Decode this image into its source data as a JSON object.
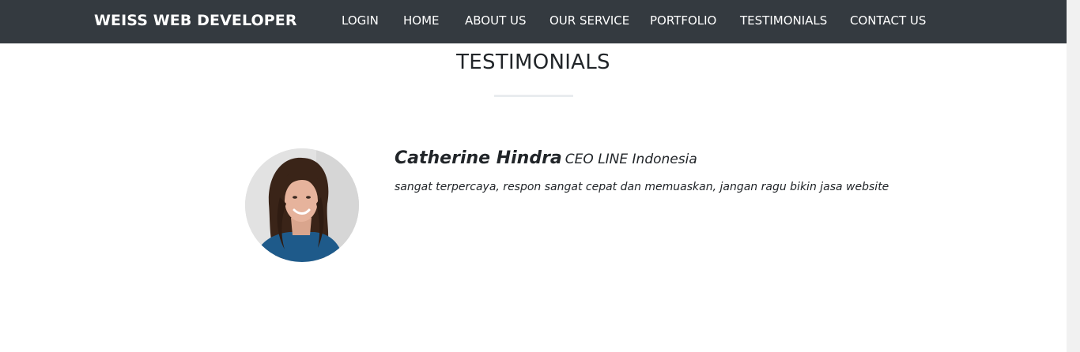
{
  "navbar": {
    "brand": "WEISS WEB DEVELOPER",
    "links": [
      {
        "label": "LOGIN"
      },
      {
        "label": "HOME"
      },
      {
        "label": "ABOUT US"
      },
      {
        "label": "OUR SERVICE"
      },
      {
        "label": "PORTFOLIO"
      },
      {
        "label": "TESTIMONIALS"
      },
      {
        "label": "CONTACT US"
      }
    ]
  },
  "testimonials": {
    "title": "TESTIMONIALS",
    "items": [
      {
        "name": "Catherine Hindra",
        "role": "CEO LINE Indonesia",
        "quote": "sangat terpercaya, respon sangat cepat dan memuaskan, jangan ragu bikin jasa website"
      }
    ]
  },
  "colors": {
    "navbar_bg": "#343a40",
    "text": "#212529",
    "divider": "#e9ecef"
  }
}
